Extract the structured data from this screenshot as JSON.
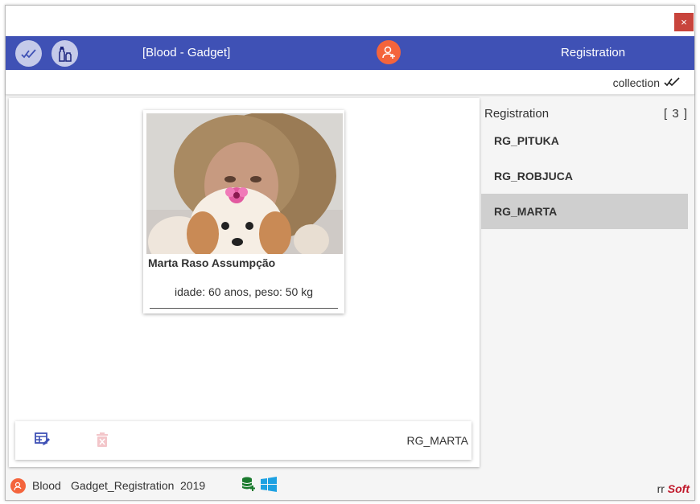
{
  "window": {
    "close_label": "×"
  },
  "appbar": {
    "title": "[Blood - Gadget]",
    "right_title": "Registration"
  },
  "subbar": {
    "label": "collection"
  },
  "card": {
    "name": "Marta Raso Assumpção",
    "info": "idade: 60 anos, peso: 50 kg"
  },
  "bottom_bar": {
    "selected_label": "RG_MARTA"
  },
  "sidebar": {
    "header": "Registration",
    "count": "[ 3 ]",
    "items": [
      {
        "label": "RG_PITUKA"
      },
      {
        "label": "RG_ROBJUCA"
      },
      {
        "label": "RG_MARTA"
      }
    ],
    "selected_index": 2
  },
  "footer": {
    "item1": "Blood",
    "item2": "Gadget_Registration",
    "item3": "2019",
    "brand_prefix": "rr",
    "brand_name": "Soft"
  },
  "colors": {
    "accent": "#3f51b5",
    "avatar": "#f4643c",
    "close": "#c8443c",
    "brand": "#c0182a",
    "selected_row": "#cfcfcf"
  },
  "icons": {
    "appbar_left_1": "double-check-icon",
    "appbar_left_2": "bottles-icon",
    "appbar_center": "add-user-icon",
    "subbar": "double-check-icon",
    "bottom_edit": "table-edit-icon",
    "bottom_delete": "delete-icon",
    "footer_db": "database-add-icon",
    "footer_os": "windows-icon"
  }
}
